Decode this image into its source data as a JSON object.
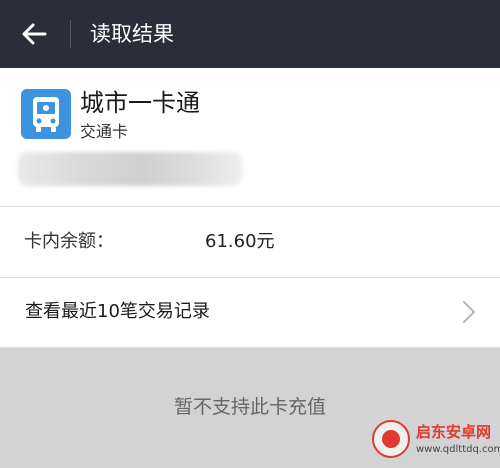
{
  "header": {
    "title": "读取结果",
    "back_icon": "arrow-left-icon"
  },
  "card": {
    "name": "城市一卡通",
    "type": "交通卡",
    "icon": "bus-icon",
    "icon_color": "#3e93de"
  },
  "balance": {
    "label": "卡内余额：",
    "value": "61.60元"
  },
  "history": {
    "label": "查看最近10笔交易记录",
    "icon": "chevron-right-icon"
  },
  "recharge": {
    "message": "暂不支持此卡充值"
  },
  "watermark": {
    "title": "启东安卓网",
    "url": "www.qdlttdq.com",
    "color": "#e0392f"
  },
  "colors": {
    "header_bg": "#2a2e3b",
    "footer_bg": "#d3d3d3"
  }
}
